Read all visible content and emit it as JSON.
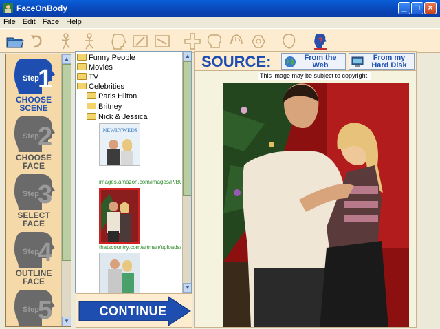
{
  "window": {
    "title": "FaceOnBody"
  },
  "menu": [
    "File",
    "Edit",
    "Face",
    "Help"
  ],
  "steps": [
    {
      "label_line1": "CHOOSE",
      "label_line2": "SCENE",
      "number": "1",
      "word": "Step"
    },
    {
      "label_line1": "CHOOSE",
      "label_line2": "FACE",
      "number": "2",
      "word": "Step"
    },
    {
      "label_line1": "SELECT",
      "label_line2": "FACE",
      "number": "3",
      "word": "Step"
    },
    {
      "label_line1": "OUTLINE",
      "label_line2": "FACE",
      "number": "4",
      "word": "Step"
    },
    {
      "label_line1": "",
      "label_line2": "",
      "number": "5",
      "word": "Step"
    }
  ],
  "tree": {
    "items": [
      "Funny People",
      "Movies",
      "TV",
      "Celebrities",
      "Paris Hilton",
      "Britney",
      "Nick & Jessica"
    ],
    "thumbs": [
      {
        "caption": "images.amazon.com/images/P/B00",
        "logo": "NEWLYWEDS"
      },
      {
        "caption": "thatscountry.com/artman/uploads/n"
      },
      {
        "caption": ""
      }
    ]
  },
  "continue_label": "CONTINUE",
  "source": {
    "label": "SOURCE:",
    "web_line1": "From the",
    "web_line2": "Web",
    "disk_line1": "From my",
    "disk_line2": "Hard Disk"
  },
  "viewer": {
    "copyright": "This image may be subject to copyright."
  }
}
